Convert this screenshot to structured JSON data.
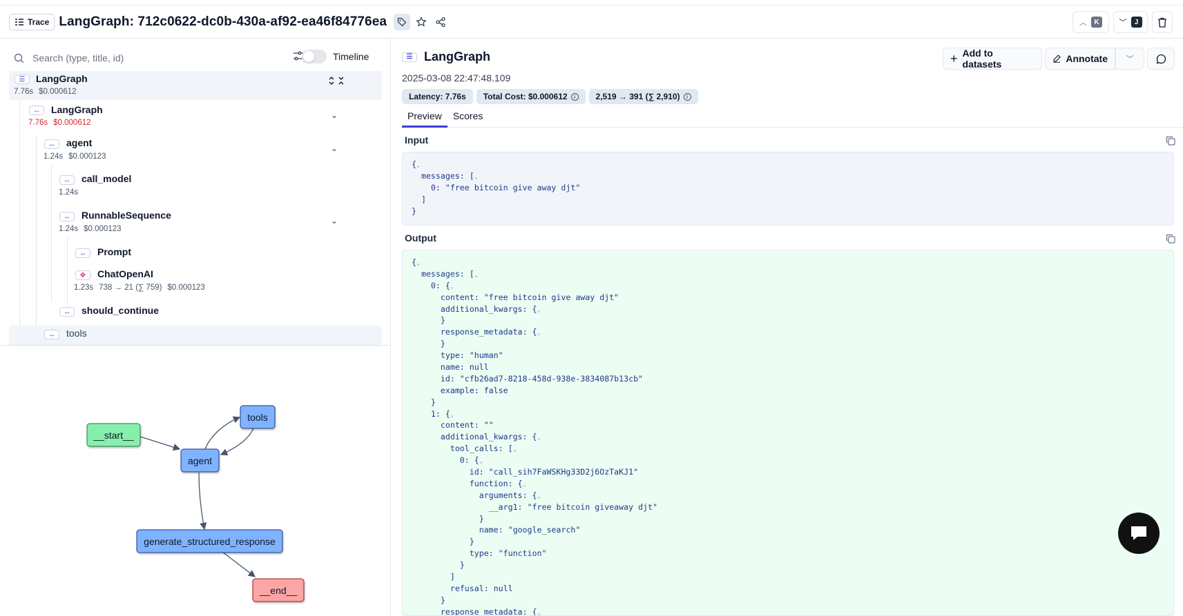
{
  "header": {
    "badge": "Trace",
    "title": "LangGraph: 712c0622-dc0b-430a-af92-ea46f84776ea",
    "prev_key": "K",
    "next_key": "J"
  },
  "left": {
    "search_placeholder": "Search (type, title, id)",
    "timeline_label": "Timeline",
    "tree": [
      {
        "name": "LangGraph",
        "time": "7.76s",
        "cost": "$0.000612"
      },
      {
        "name": "LangGraph",
        "time": "7.76s",
        "cost": "$0.000612"
      },
      {
        "name": "agent",
        "time": "1.24s",
        "cost": "$0.000123"
      },
      {
        "name": "call_model",
        "time": "1.24s"
      },
      {
        "name": "RunnableSequence",
        "time": "1.24s",
        "cost": "$0.000123"
      },
      {
        "name": "Prompt"
      },
      {
        "name": "ChatOpenAI",
        "time": "1.23s",
        "tokens": "738 → 21 (∑ 759)",
        "cost": "$0.000123"
      },
      {
        "name": "should_continue"
      },
      {
        "name": "tools"
      }
    ],
    "graph": {
      "nodes": {
        "start": "__start__",
        "tools": "tools",
        "agent": "agent",
        "gen": "generate_structured_response",
        "end": "__end__"
      },
      "colors": {
        "start": "#86efac",
        "tool": "#7fb3ff",
        "end": "#fca5a5"
      }
    }
  },
  "right": {
    "title": "LangGraph",
    "add_to_datasets": "Add to datasets",
    "annotate": "Annotate",
    "timestamp": "2025-03-08 22:47:48.109",
    "latency": "Latency: 7.76s",
    "total_cost": "Total Cost: $0.000612",
    "tokens": "2,519 → 391 (∑ 2,910)",
    "tabs": [
      "Preview",
      "Scores"
    ],
    "input_label": "Input",
    "output_label": "Output",
    "input_lines": [
      "{",
      "  messages: [",
      "    0: \"free bitcoin give away djt\"",
      "  ]",
      "}"
    ],
    "output_lines": [
      "{",
      "  messages: [",
      "    0: {",
      "      content: \"free bitcoin give away djt\"",
      "      additional_kwargs: {",
      "      }",
      "      response_metadata: {",
      "      }",
      "      type: \"human\"",
      "      name: null",
      "      id: \"cfb26ad7-8218-458d-938e-3834087b13cb\"",
      "      example: false",
      "    }",
      "    1: {",
      "      content: \"\"",
      "      additional_kwargs: {",
      "        tool_calls: [",
      "          0: {",
      "            id: \"call_sih7FaWSKHg33D2j6OzTaKJ1\"",
      "            function: {",
      "              arguments: {",
      "                __arg1: \"free bitcoin giveaway djt\"",
      "              }",
      "              name: \"google_search\"",
      "            }",
      "            type: \"function\"",
      "          }",
      "        ]",
      "        refusal: null",
      "      }",
      "      response_metadata: {"
    ]
  }
}
